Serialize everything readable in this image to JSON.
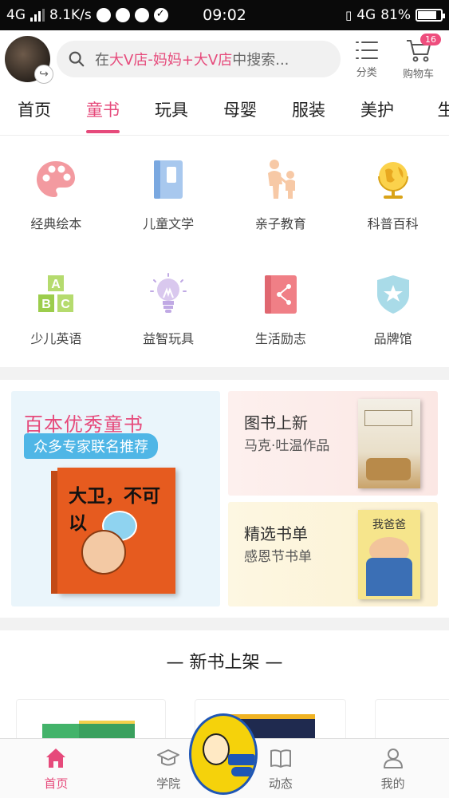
{
  "status_bar": {
    "network": "4G",
    "speed": "8.1K/s",
    "time": "09:02",
    "network_right": "4G",
    "battery": "81%",
    "battery_level": 0.81
  },
  "header": {
    "search_prefix": "在",
    "search_store": "大V店",
    "search_dash": " - ",
    "search_brand": "妈妈+大V店",
    "search_suffix": "中搜索...",
    "category_label": "分类",
    "cart_label": "购物车",
    "cart_count": "16"
  },
  "tabs": [
    {
      "label": "首页"
    },
    {
      "label": "童书"
    },
    {
      "label": "玩具"
    },
    {
      "label": "母婴"
    },
    {
      "label": "服装"
    },
    {
      "label": "美护"
    },
    {
      "label": "生"
    }
  ],
  "active_tab": 1,
  "categories": [
    {
      "label": "经典绘本",
      "icon": "palette-icon"
    },
    {
      "label": "儿童文学",
      "icon": "book-icon"
    },
    {
      "label": "亲子教育",
      "icon": "parent-child-icon"
    },
    {
      "label": "科普百科",
      "icon": "globe-icon"
    },
    {
      "label": "少儿英语",
      "icon": "abc-blocks-icon"
    },
    {
      "label": "益智玩具",
      "icon": "lightbulb-icon"
    },
    {
      "label": "生活励志",
      "icon": "share-book-icon"
    },
    {
      "label": "品牌馆",
      "icon": "star-shield-icon"
    }
  ],
  "promo": {
    "main_title": "百本优秀童书",
    "main_subtitle": "众多专家联名推荐",
    "main_book_title": "大卫，不可以",
    "card1_title": "图书上新",
    "card1_subtitle": "马克·吐温作品",
    "card2_title": "精选书单",
    "card2_subtitle": "感恩节书单",
    "card2_book_title": "我爸爸"
  },
  "new_books": {
    "title": "— 新书上架 —"
  },
  "bottom_nav": [
    {
      "label": "首页",
      "icon": "home-icon"
    },
    {
      "label": "学院",
      "icon": "graduation-cap-icon"
    },
    {
      "label": "动态",
      "icon": "open-book-icon"
    },
    {
      "label": "我的",
      "icon": "user-icon"
    }
  ],
  "colors": {
    "accent": "#e64a7b",
    "promo_blue": "#4fb6e6"
  }
}
